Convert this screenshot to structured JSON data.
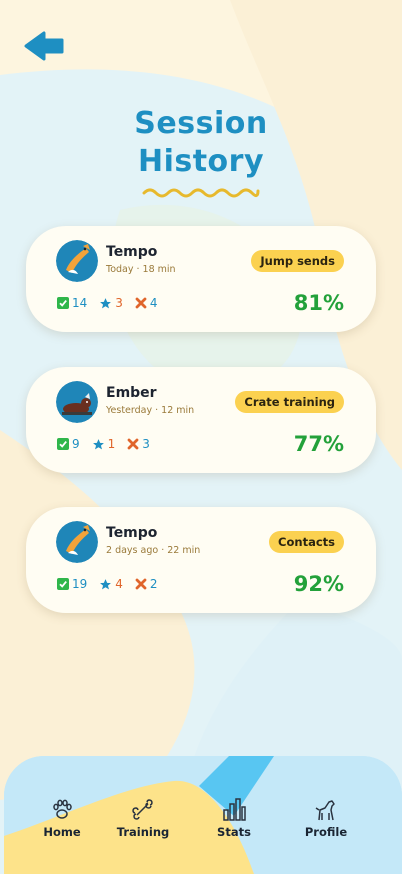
{
  "header": {
    "title_line1": "Session",
    "title_line2": "History"
  },
  "sessions": [
    {
      "dog": "Tempo",
      "meta": "Today · 18 min",
      "tag": "Jump sends",
      "correct": "14",
      "stars": "3",
      "misses": "4",
      "percent": "81%",
      "avatar": "fox-dog-avatar"
    },
    {
      "dog": "Ember",
      "meta": "Yesterday · 12 min",
      "tag": "Crate training",
      "correct": "9",
      "stars": "1",
      "misses": "3",
      "percent": "77%",
      "avatar": "brown-dog-avatar"
    },
    {
      "dog": "Tempo",
      "meta": "2 days ago · 22 min",
      "tag": "Contacts",
      "correct": "19",
      "stars": "4",
      "misses": "2",
      "percent": "92%",
      "avatar": "fox-dog-avatar"
    }
  ],
  "nav": {
    "items": [
      {
        "label": "Home",
        "icon": "paw-icon"
      },
      {
        "label": "Training",
        "icon": "bone-icon"
      },
      {
        "label": "Stats",
        "icon": "bar-chart-icon"
      },
      {
        "label": "Profile",
        "icon": "dog-icon"
      }
    ]
  },
  "colors": {
    "accent": "#1e8fc2",
    "tag": "#fbd150",
    "percent": "#23a13a",
    "miss": "#e0652b",
    "background": "#fdf5df"
  }
}
